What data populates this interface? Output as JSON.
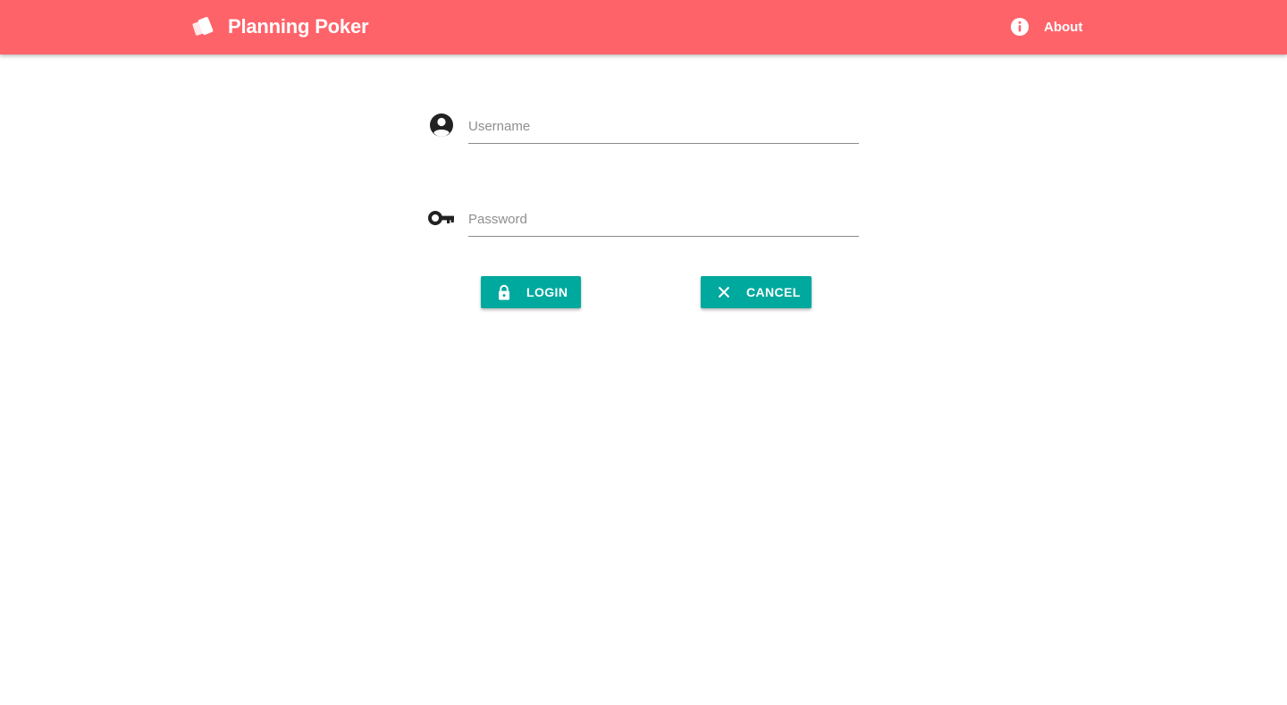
{
  "header": {
    "brand_icon": "cards-icon",
    "title": "Planning Poker",
    "about_icon": "info-icon",
    "about_label": "About",
    "bg_color": "#ff636a"
  },
  "form": {
    "username": {
      "icon": "account-circle-icon",
      "placeholder": "Username",
      "value": ""
    },
    "password": {
      "icon": "key-icon",
      "placeholder": "Password",
      "value": ""
    },
    "login": {
      "icon": "lock-icon",
      "label": "LOGIN"
    },
    "cancel": {
      "icon": "close-icon",
      "label": "CANCEL"
    },
    "button_color": "#00a99d"
  }
}
